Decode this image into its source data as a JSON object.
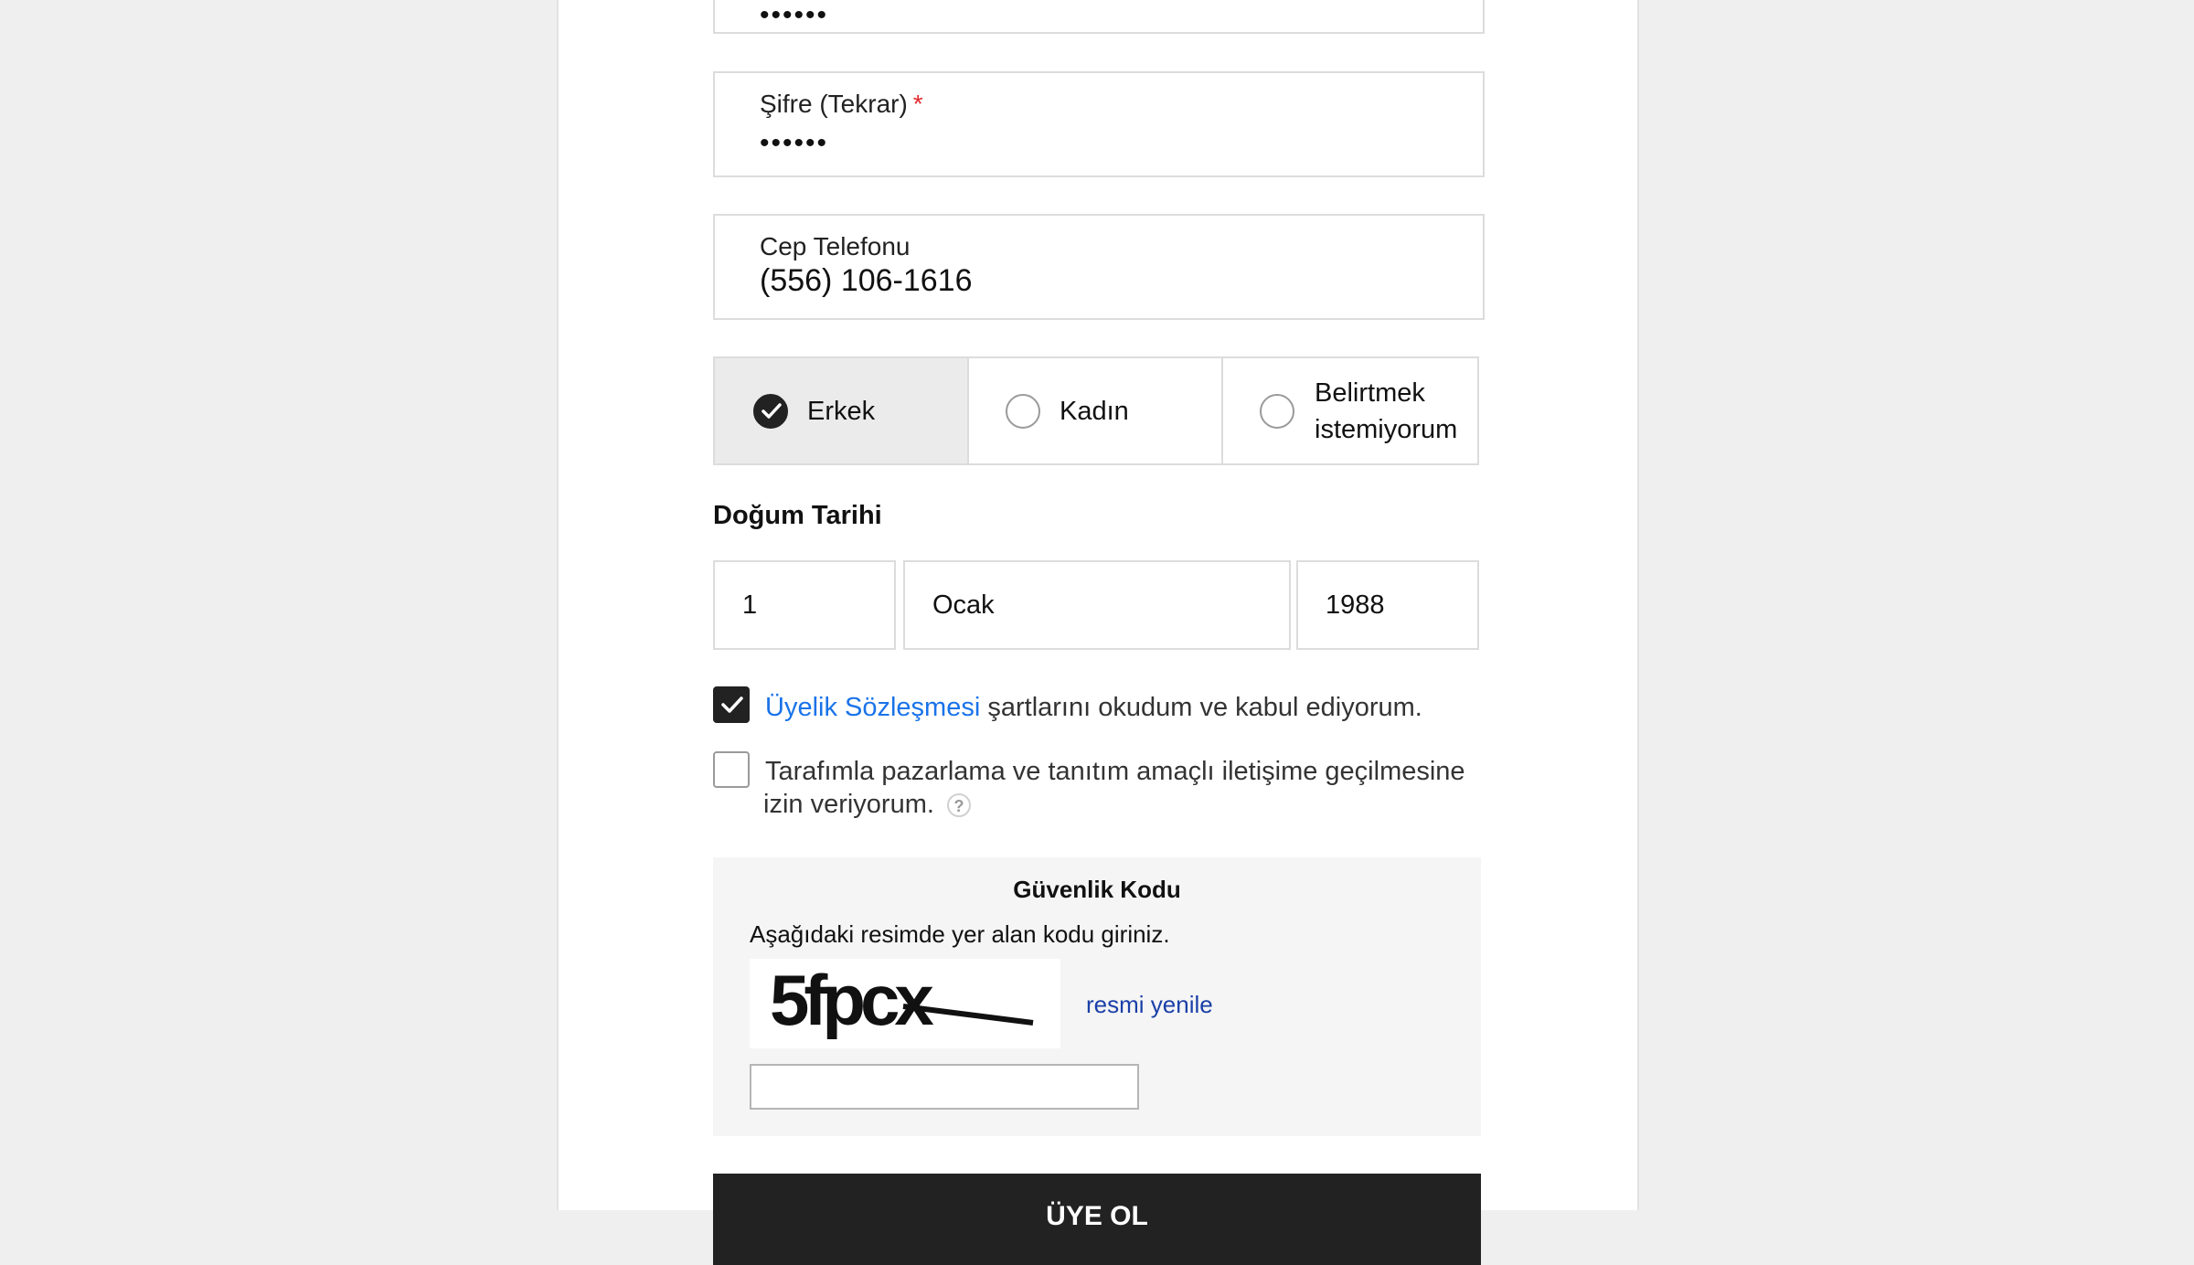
{
  "form": {
    "password_value": "••••••",
    "password_confirm": {
      "label": "Şifre (Tekrar)",
      "required_mark": "*",
      "value": "••••••"
    },
    "phone": {
      "label": "Cep Telefonu",
      "value": "(556) 106-1616"
    },
    "gender": {
      "options": [
        {
          "label": "Erkek",
          "selected": true
        },
        {
          "label": "Kadın",
          "selected": false
        },
        {
          "label_line1": "Belirtmek",
          "label_line2": "istemiyorum",
          "selected": false
        }
      ]
    },
    "birth_date": {
      "title": "Doğum Tarihi",
      "day": "1",
      "month": "Ocak",
      "year": "1988"
    },
    "consents": [
      {
        "link_text": "Üyelik Sözleşmesi",
        "text": " şartlarını okudum ve kabul ediyorum.",
        "checked": true
      },
      {
        "text_line1": "Tarafımla pazarlama ve tanıtım amaçlı iletişime geçilmesine",
        "text_line2": "izin veriyorum.",
        "help_icon": "?",
        "checked": false
      }
    ],
    "captcha": {
      "title": "Güvenlik Kodu",
      "instruction": "Aşağıdaki resimde yer alan kodu giriniz.",
      "image_text": "5fpcx",
      "refresh_label": "resmi yenile",
      "input_value": ""
    },
    "submit_label": "ÜYE OL"
  },
  "colors": {
    "required": "#e1282d",
    "link": "#1a73e8",
    "refresh_link": "#1a3fa8",
    "selected_bg": "#ebebeb",
    "button_bg": "#222222"
  }
}
